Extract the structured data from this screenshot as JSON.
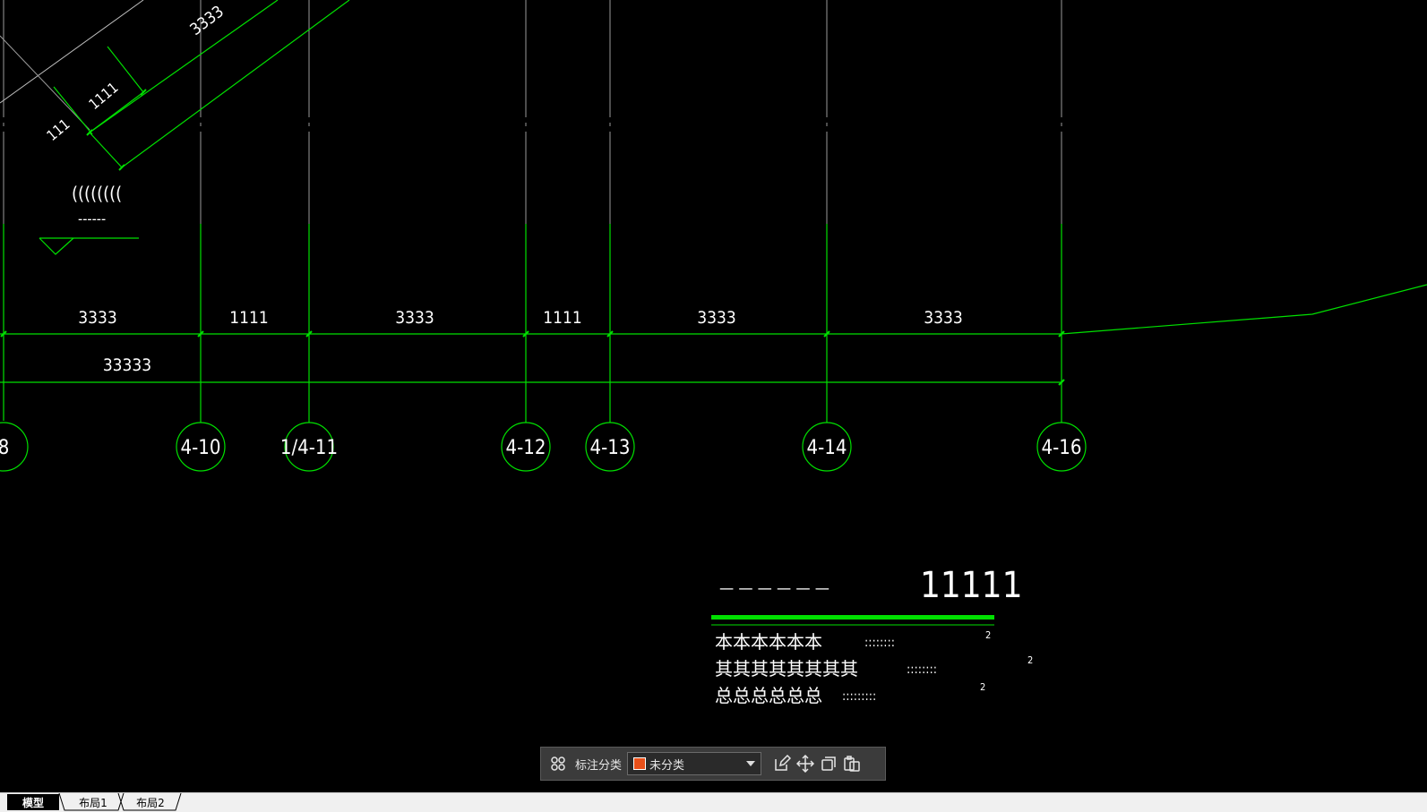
{
  "drawing": {
    "dim_labels": {
      "d1": "3333",
      "d2": "1111",
      "d3": "3333",
      "d4": "1111",
      "d5": "3333",
      "d6": "3333",
      "total": "33333",
      "diag_3333": "3333",
      "diag_1111": "1111",
      "diag_111": "111",
      "paren": "((((((((",
      "dashes": "------"
    },
    "grid_bubbles": [
      "8",
      "4-10",
      "1/4-11",
      "4-12",
      "4-13",
      "4-14",
      "4-16"
    ],
    "title_block": {
      "dash_row": "— — — — — —",
      "number": "11111",
      "row1_text": "本本本本本本",
      "row1_dots": "::::::::",
      "row1_sup": "2",
      "row2_text": "其其其其其其其其",
      "row2_dots": "::::::::",
      "row2_sup": "2",
      "row3_text": "总总总总总总",
      "row3_dots": ":::::::::",
      "row3_sup": "2"
    },
    "colors": {
      "green": "#00e000",
      "white": "#ffffff",
      "grey": "#9a9a9a"
    }
  },
  "toolbar": {
    "label": "标注分类",
    "select_value": "未分类",
    "swatch_color": "#e8501a",
    "icons": [
      "grid-icon",
      "edit-icon",
      "move-icon",
      "copy-icon",
      "paste-icon"
    ]
  },
  "tabs": [
    "模型",
    "布局1",
    "布局2"
  ]
}
